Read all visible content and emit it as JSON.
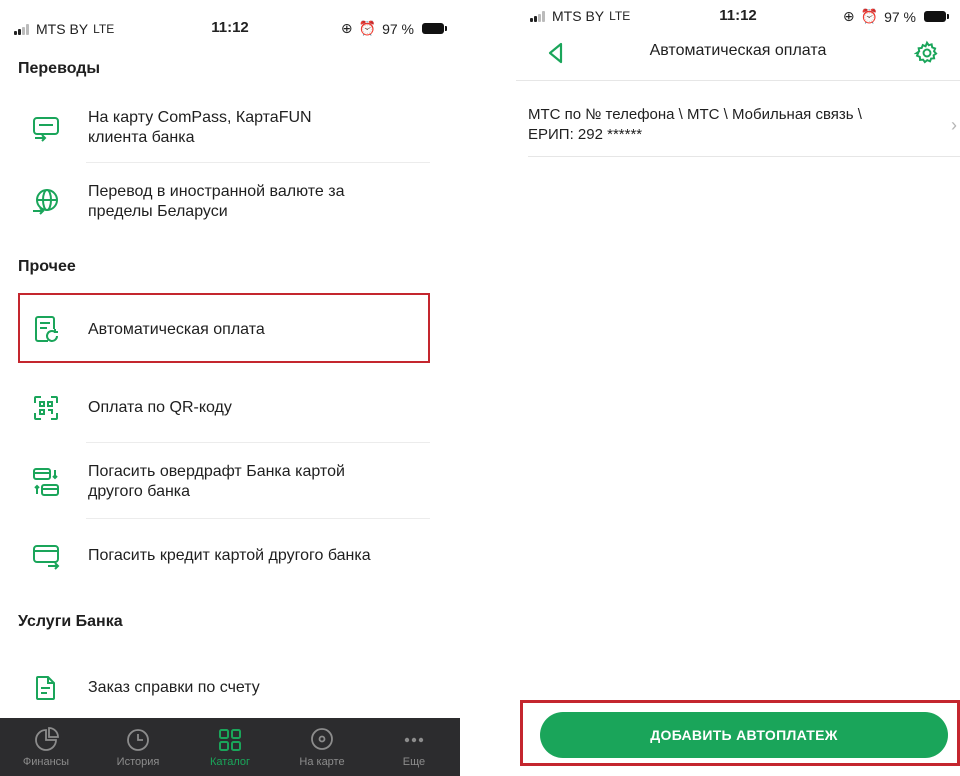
{
  "status": {
    "carrier": "MTS BY",
    "network": "LTE",
    "time": "11:12",
    "battery": "97 %"
  },
  "left_screen": {
    "sections": [
      {
        "title": "Переводы",
        "items": [
          {
            "line1": "На карту ComPass, КартаFUN",
            "line2": "клиента банка",
            "icon": "card-transfer-icon"
          },
          {
            "line1": "Перевод в иностранной валюте за",
            "line2": "пределы Беларуси",
            "icon": "globe-transfer-icon"
          }
        ]
      },
      {
        "title": "Прочее",
        "items": [
          {
            "line1": "Автоматическая оплата",
            "line2": "",
            "icon": "auto-payment-icon"
          },
          {
            "line1": "Оплата по QR-коду",
            "line2": "",
            "icon": "qr-code-icon"
          },
          {
            "line1": "Погасить овердрафт Банка картой",
            "line2": "другого банка",
            "icon": "overdraft-cards-icon"
          },
          {
            "line1": "Погасить кредит картой другого банка",
            "line2": "",
            "icon": "credit-card-icon"
          }
        ]
      },
      {
        "title": "Услуги Банка",
        "items": [
          {
            "line1": "Заказ справки по счету",
            "line2": "",
            "icon": "document-icon"
          }
        ]
      }
    ],
    "tabs": [
      {
        "label": "Финансы",
        "icon": "pie-chart-icon"
      },
      {
        "label": "История",
        "icon": "clock-icon"
      },
      {
        "label": "Каталог",
        "icon": "grid-icon",
        "active": true
      },
      {
        "label": "На карте",
        "icon": "location-pin-icon"
      },
      {
        "label": "Еще",
        "icon": "more-dots-icon"
      }
    ]
  },
  "right_screen": {
    "title": "Автоматическая оплата",
    "payment": {
      "line1": "МТС по № телефона \\ МТС \\ Мобильная связь \\",
      "line2": "ЕРИП: 292 ******"
    },
    "add_button": "ДОБАВИТЬ АВТОПЛАТЕЖ"
  },
  "colors": {
    "accent": "#1aa55a",
    "highlight": "#c4262e",
    "tabbar": "#2c2c2e"
  }
}
